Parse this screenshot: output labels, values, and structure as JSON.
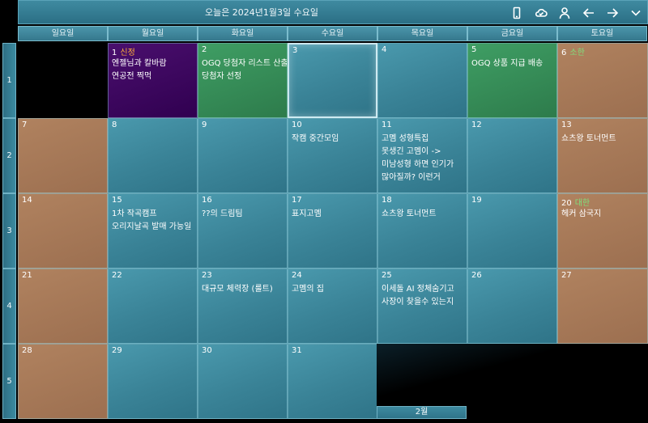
{
  "header": {
    "title": "오늘은 2024년1월3일 수요일",
    "icons": [
      "mobile-icon",
      "cloud-sync-icon",
      "user-icon",
      "arrow-left-icon",
      "arrow-right-icon",
      "chevron-down-icon"
    ]
  },
  "weekdays": [
    "일요일",
    "월요일",
    "화요일",
    "수요일",
    "목요일",
    "금요일",
    "토요일"
  ],
  "weeks": [
    "1",
    "2",
    "3",
    "4",
    "5"
  ],
  "days": {
    "d1": {
      "num": "1",
      "holiday": "신정",
      "events": [
        "엔젤님과 칼바람",
        "연공전 찍먹"
      ]
    },
    "d2": {
      "num": "2",
      "events": [
        "OGQ 당첨자 리스트 산출",
        "당첨자 선정"
      ]
    },
    "d3": {
      "num": "3"
    },
    "d4": {
      "num": "4"
    },
    "d5": {
      "num": "5",
      "events": [
        "OGQ 상품 지급 배송"
      ]
    },
    "d6": {
      "num": "6",
      "holiday": "소한"
    },
    "d7": {
      "num": "7"
    },
    "d8": {
      "num": "8"
    },
    "d9": {
      "num": "9"
    },
    "d10": {
      "num": "10",
      "events": [
        "작캠 중간모임"
      ]
    },
    "d11": {
      "num": "11",
      "events": [
        "고멤 성형특집",
        "못생긴 고멤이 -> 미남성형 하면 인기가 많아질까? 이런거"
      ]
    },
    "d12": {
      "num": "12"
    },
    "d13": {
      "num": "13",
      "events": [
        "쇼츠왕 토너먼트"
      ]
    },
    "d14": {
      "num": "14"
    },
    "d15": {
      "num": "15",
      "events": [
        "1차 작곡캠프 오리지날곡 발매 가능일"
      ]
    },
    "d16": {
      "num": "16",
      "events": [
        "??의 드림팀"
      ]
    },
    "d17": {
      "num": "17",
      "events": [
        "표지고멤"
      ]
    },
    "d18": {
      "num": "18",
      "events": [
        "쇼츠왕 토너먼트"
      ]
    },
    "d19": {
      "num": "19"
    },
    "d20": {
      "num": "20",
      "holiday": "대한",
      "events": [
        "헤커 삼국지"
      ]
    },
    "d21": {
      "num": "21"
    },
    "d22": {
      "num": "22"
    },
    "d23": {
      "num": "23",
      "events": [
        "대규모 체력장 (룰트)"
      ]
    },
    "d24": {
      "num": "24",
      "events": [
        "고멤의 집"
      ]
    },
    "d25": {
      "num": "25",
      "events": [
        "이세돌 AI 정체숨기고 사장이 찾을수 있는지"
      ]
    },
    "d26": {
      "num": "26"
    },
    "d27": {
      "num": "27"
    },
    "d28": {
      "num": "28"
    },
    "d29": {
      "num": "29"
    },
    "d30": {
      "num": "30"
    },
    "d31": {
      "num": "31"
    }
  },
  "next_month": {
    "label": "2월"
  },
  "colors": {
    "weekday_cell": "#3a8397",
    "weekend_cell": "#a57656",
    "holiday_purple": "#3a0a5e",
    "event_green": "#36885a",
    "holiday_orange_text": "#ffb03a",
    "holiday_green_text": "#7ee07e"
  }
}
